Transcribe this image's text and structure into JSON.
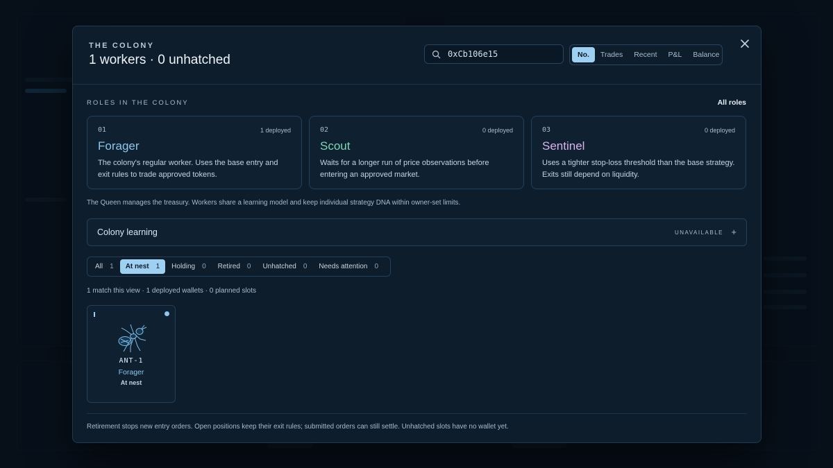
{
  "modal": {
    "eyebrow": "THE COLONY",
    "title": "1 workers · 0 unhatched",
    "search_value": "0xCb106e15",
    "sort_options": [
      "No.",
      "Trades",
      "Recent",
      "P&L",
      "Balance"
    ],
    "active_sort": "No."
  },
  "roles": {
    "section_label": "ROLES IN THE COLONY",
    "all_roles_link": "All roles",
    "items": [
      {
        "num": "01",
        "deployed": "1 deployed",
        "name": "Forager",
        "desc": "The colony's regular worker. Uses the base entry and exit rules to trade approved tokens.",
        "color": "#8fc5ea"
      },
      {
        "num": "02",
        "deployed": "0 deployed",
        "name": "Scout",
        "desc": "Waits for a longer run of price observations before entering an approved market.",
        "color": "#7fd6b4"
      },
      {
        "num": "03",
        "deployed": "0 deployed",
        "name": "Sentinel",
        "desc": "Uses a tighter stop-loss threshold than the base strategy. Exits still depend on liquidity.",
        "color": "#d9b3ec"
      }
    ],
    "queen_note": "The Queen manages the treasury. Workers share a learning model and keep individual strategy DNA within owner-set limits."
  },
  "learning": {
    "label": "Colony learning",
    "status": "UNAVAILABLE",
    "toggle": "+"
  },
  "filters": [
    {
      "label": "All",
      "count": "1"
    },
    {
      "label": "At nest",
      "count": "1",
      "active": true
    },
    {
      "label": "Holding",
      "count": "0"
    },
    {
      "label": "Retired",
      "count": "0"
    },
    {
      "label": "Unhatched",
      "count": "0"
    },
    {
      "label": "Needs attention",
      "count": "0"
    }
  ],
  "match_note": "1 match this view · 1 deployed wallets · 0 planned slots",
  "workers": [
    {
      "name": "ANT-1",
      "role": "Forager",
      "state": "At nest"
    }
  ],
  "footer_note": "Retirement stops new entry orders. Open positions keep their exit rules; submitted orders can still settle. Unhatched slots have no wallet yet.",
  "icons": {
    "search": "search-icon",
    "close": "close-icon",
    "ant": "ant-icon"
  },
  "colors": {
    "accent": "#9fd0f2",
    "modal_bg": "#0d1d2c",
    "border": "#22405a"
  }
}
